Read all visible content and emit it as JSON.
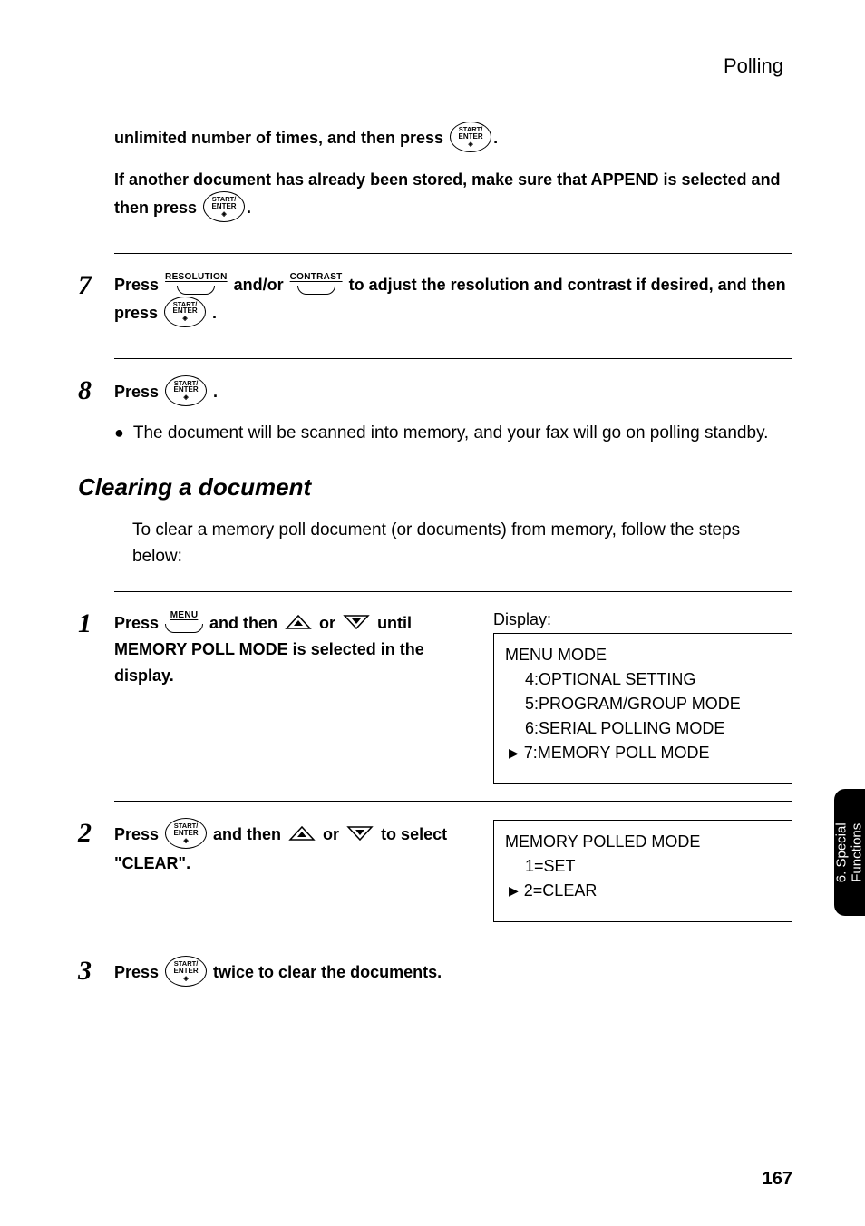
{
  "header": {
    "section": "Polling"
  },
  "step6": {
    "line1_a": "unlimited number of times, and then press ",
    "line1_b": ".",
    "line2_a": "If another document has already been stored, make sure that APPEND is selected and then press ",
    "line2_b": "."
  },
  "step7": {
    "num": "7",
    "a": "Press ",
    "b": " and/or ",
    "c": " to adjust the resolution and contrast if desired, and then press ",
    "d": " ."
  },
  "step8": {
    "num": "8",
    "a": "Press ",
    "b": " .",
    "bullet": "The document will be scanned into memory, and your fax will go on polling standby."
  },
  "clearing": {
    "title": "Clearing a document",
    "intro": "To clear a memory poll document (or documents) from memory, follow the steps below:"
  },
  "c1": {
    "num": "1",
    "a": "Press ",
    "b": " and then ",
    "c": " or ",
    "d": " until MEMORY POLL MODE is selected in the display.",
    "display_label": "Display:",
    "lcd": {
      "l1": "MENU MODE",
      "l2": "4:OPTIONAL SETTING",
      "l3": "5:PROGRAM/GROUP MODE",
      "l4": "6:SERIAL POLLING MODE",
      "l5": "7:MEMORY POLL MODE"
    }
  },
  "c2": {
    "num": "2",
    "a": "Press ",
    "b": " and then ",
    "c": " or ",
    "d": " to select \"CLEAR\".",
    "lcd": {
      "l1": "MEMORY POLLED MODE",
      "l2": "1=SET",
      "l3": "2=CLEAR"
    }
  },
  "c3": {
    "num": "3",
    "a": "Press ",
    "b": " twice to clear the documents."
  },
  "buttons": {
    "start_l1": "START/",
    "start_l2": "ENTER",
    "resolution": "RESOLUTION",
    "contrast": "CONTRAST",
    "menu": "MENU"
  },
  "sidetab": {
    "l1": "6. Special",
    "l2": "Functions"
  },
  "pagenum": "167"
}
